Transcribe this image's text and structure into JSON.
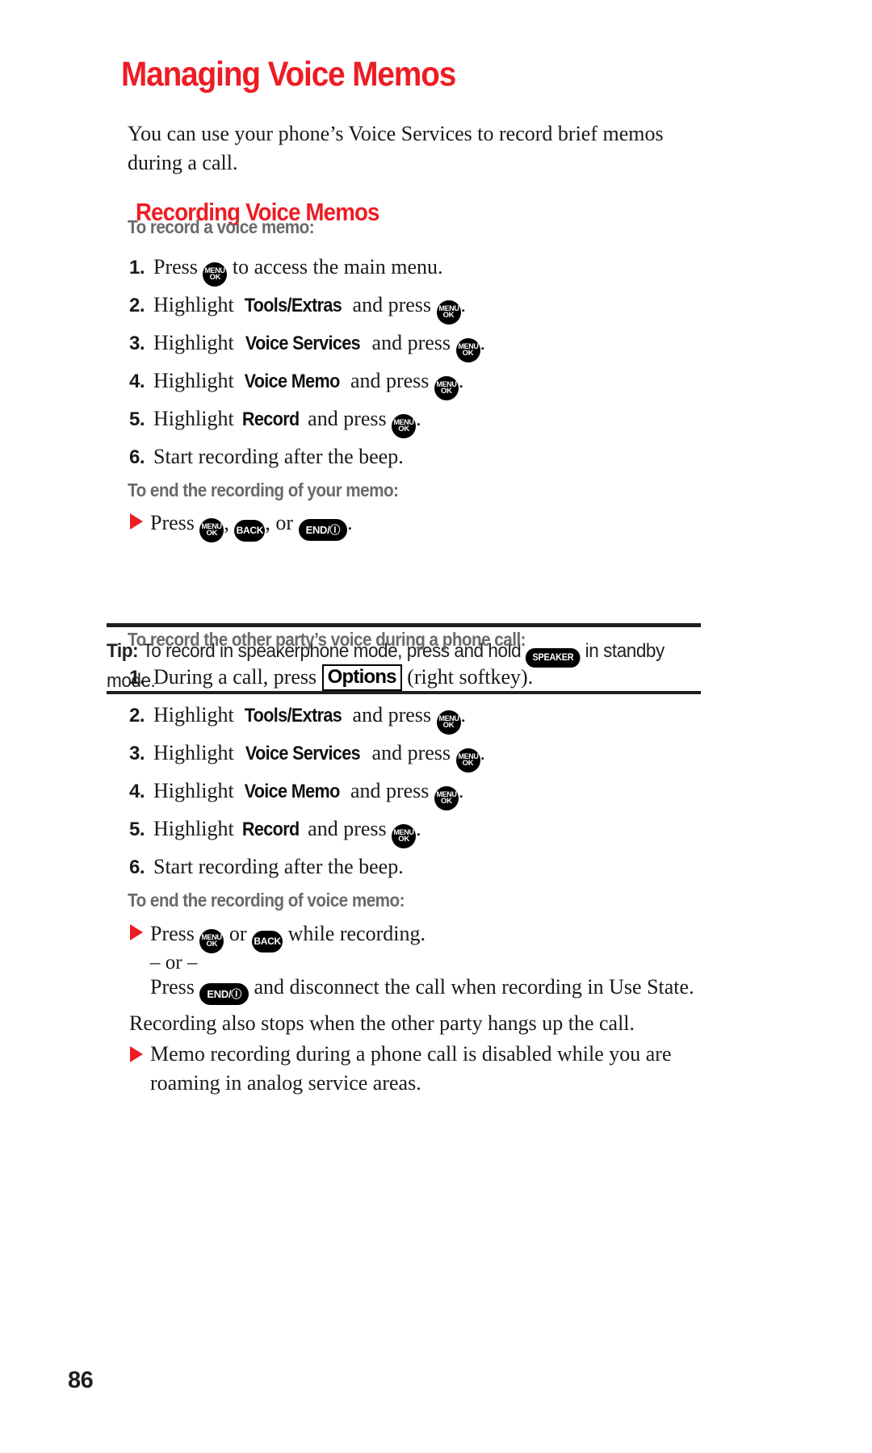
{
  "document": {
    "title": "Managing Voice Memos",
    "intro": "You can use your phone’s Voice Services to record brief memos during a call.",
    "page_number": "86",
    "accent_color": "#ed1c24",
    "subhead_color": "#6a6a6a",
    "rule_color": "#231f20"
  },
  "section_recording": {
    "heading": "Recording Voice Memos",
    "subhead_record": "To record a voice memo:",
    "steps": [
      {
        "num": "1.",
        "before": "Press",
        "key": "menu-ok-key",
        "after": "to access the main menu."
      },
      {
        "num": "2.",
        "before": "Highlight",
        "term": "Tools/Extras",
        "mid": "and press",
        "key": "menu-ok-key",
        "after": "."
      },
      {
        "num": "3.",
        "before": "Highlight",
        "term": "Voice Services",
        "mid": "and press",
        "key": "menu-ok-key",
        "after": "."
      },
      {
        "num": "4.",
        "before": "Highlight",
        "term": "Voice Memo",
        "mid": "and press",
        "key": "menu-ok-key",
        "after": "."
      },
      {
        "num": "5.",
        "before": "Highlight",
        "term": "Record",
        "mid": "and press",
        "key": "menu-ok-key",
        "after": "."
      },
      {
        "num": "6.",
        "before": "Start recording after the beep."
      }
    ],
    "subhead_end": "To end the recording of your memo:",
    "end_bullet": {
      "before": "Press",
      "key1": "menu-ok-key",
      "sep1": ",",
      "key2": "back-key",
      "sep2": ", or",
      "key3": "end-power-key",
      "after": "."
    }
  },
  "tip": {
    "label": "Tip:",
    "text_before": "To record in speakerphone mode, press and hold",
    "key": "speaker-key",
    "text_after": "in standby mode."
  },
  "section_other_party": {
    "subhead_record": "To record the other party’s voice during a phone call:",
    "steps": [
      {
        "num": "1.",
        "before": "During a call, press",
        "softkey": "Options",
        "after": "(right softkey)."
      },
      {
        "num": "2.",
        "before": "Highlight",
        "term": "Tools/Extras",
        "mid": "and press",
        "key": "menu-ok-key",
        "after": "."
      },
      {
        "num": "3.",
        "before": "Highlight",
        "term": "Voice Services",
        "mid": "and press",
        "key": "menu-ok-key",
        "after": "."
      },
      {
        "num": "4.",
        "before": "Highlight",
        "term": "Voice Memo",
        "mid": "and press",
        "key": "menu-ok-key",
        "after": "."
      },
      {
        "num": "5.",
        "before": "Highlight",
        "term": "Record",
        "mid": "and press",
        "key": "menu-ok-key",
        "after": "."
      },
      {
        "num": "6.",
        "before": "Start recording after the beep."
      }
    ],
    "subhead_end": "To end the recording of voice memo:",
    "end_bullet": {
      "before": "Press",
      "key1": "menu-ok-key",
      "mid": "or",
      "key2": "back-key",
      "after": "while recording."
    },
    "or_divider": "– or –",
    "end_alt": {
      "before": "Press",
      "key": "end-power-key",
      "after": "and disconnect the call when recording in Use State."
    },
    "note_stop": "Recording also stops when the other party hangs up the call.",
    "note_roaming": "Memo recording during a phone call is disabled while you are roaming in analog service areas."
  },
  "keys": {
    "menu_ok": {
      "line1": "MENU",
      "line2": "OK"
    },
    "back": "BACK",
    "end_power": "END/Ⓘ",
    "speaker": "SPEAKER"
  }
}
